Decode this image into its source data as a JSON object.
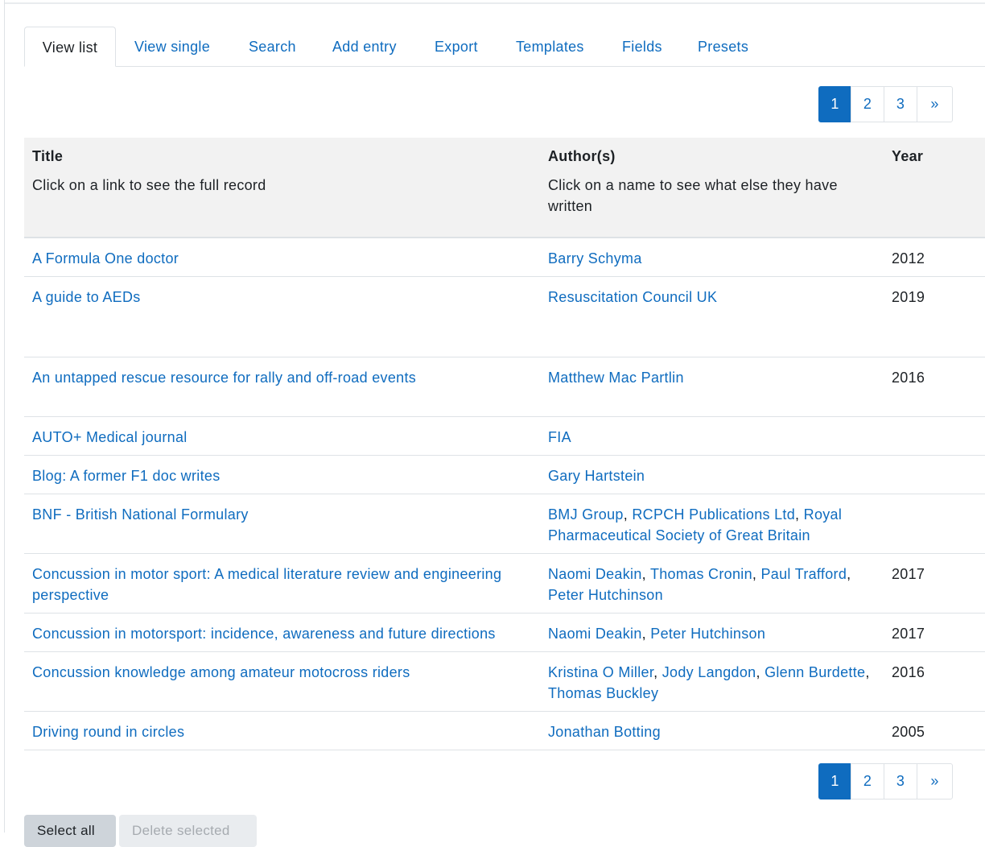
{
  "tabs": [
    "View list",
    "View single",
    "Search",
    "Add entry",
    "Export",
    "Templates",
    "Fields",
    "Presets"
  ],
  "pagination": {
    "pages": [
      "1",
      "2",
      "3"
    ],
    "next": "»",
    "current": "1"
  },
  "table": {
    "headers": [
      {
        "title": "Title",
        "sub": "Click on a link to see the full record"
      },
      {
        "title": "Author(s)",
        "sub": "Click on a name to see what else they have written"
      },
      {
        "title": "Year",
        "sub": ""
      }
    ],
    "rows": [
      {
        "title": "A Formula One doctor",
        "authors": [
          "Barry Schyma"
        ],
        "year": "2012"
      },
      {
        "title": "A guide to AEDs",
        "authors": [
          "Resuscitation Council UK"
        ],
        "year": "2019"
      },
      {
        "title": "An untapped rescue resource for rally and off-road events",
        "authors": [
          "Matthew Mac Partlin"
        ],
        "year": "2016"
      },
      {
        "title": "AUTO+ Medical journal",
        "authors": [
          "FIA"
        ],
        "year": ""
      },
      {
        "title": "Blog: A former F1 doc writes",
        "authors": [
          "Gary Hartstein"
        ],
        "year": ""
      },
      {
        "title": "BNF - British National Formulary",
        "authors": [
          "BMJ Group",
          "RCPCH Publications Ltd",
          "Royal Pharmaceutical Society of Great Britain"
        ],
        "year": ""
      },
      {
        "title": "Concussion in motor sport: A medical literature review and engineering perspective",
        "authors": [
          "Naomi Deakin",
          "Thomas Cronin",
          "Paul Trafford",
          "Peter Hutchinson"
        ],
        "year": "2017"
      },
      {
        "title": "Concussion in motorsport: incidence, awareness and future directions",
        "authors": [
          "Naomi Deakin",
          "Peter Hutchinson"
        ],
        "year": "2017"
      },
      {
        "title": "Concussion knowledge among amateur motocross riders",
        "authors": [
          "Kristina O Miller",
          "Jody Langdon",
          "Glenn Burdette",
          "Thomas Buckley"
        ],
        "year": "2016"
      },
      {
        "title": "Driving round in circles",
        "authors": [
          "Jonathan Botting"
        ],
        "year": "2005"
      }
    ]
  },
  "buttons": {
    "select_all": "Select all",
    "delete_selected": "Delete selected"
  }
}
